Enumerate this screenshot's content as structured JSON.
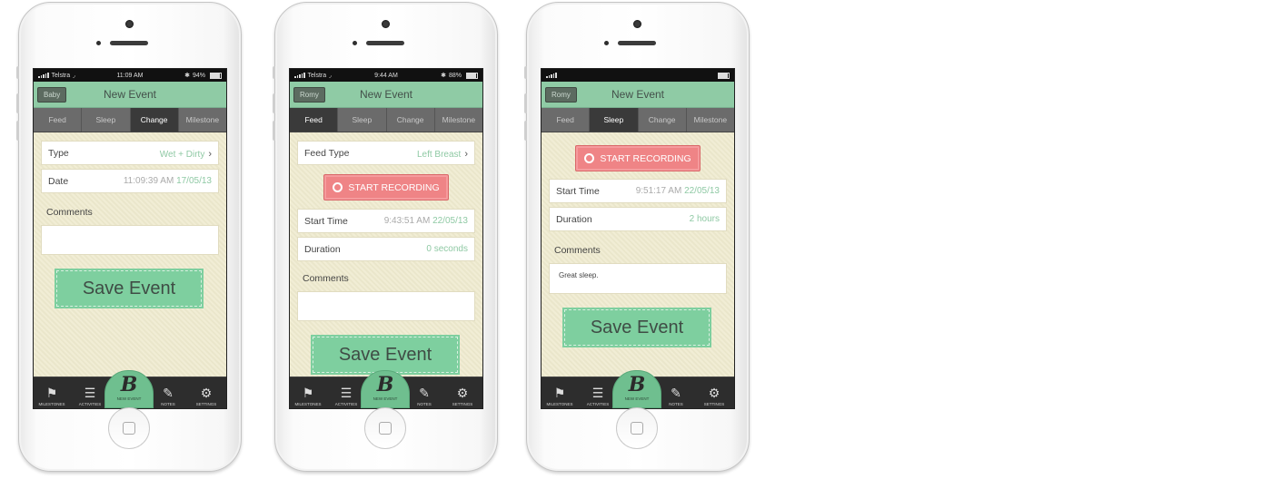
{
  "tab_labels": {
    "milestones": "MILESTONES",
    "activities": "ACTIVITIES",
    "new_event": "NEW EVENT",
    "notes": "NOTES",
    "settings": "SETTINGS"
  },
  "segments": [
    "Feed",
    "Sleep",
    "Change",
    "Milestone"
  ],
  "phones": [
    {
      "status": {
        "carrier": "Telstra",
        "time": "11:09 AM",
        "battery": "94%"
      },
      "nav": {
        "back": "Baby",
        "title": "New Event"
      },
      "active_segment": "Change",
      "type_row": {
        "label": "Type",
        "value": "Wet + Dirty"
      },
      "date_row": {
        "label": "Date",
        "time": "11:09:39 AM",
        "date": "17/05/13"
      },
      "comments_label": "Comments",
      "comments_value": "",
      "save_label": "Save Event"
    },
    {
      "status": {
        "carrier": "Telstra",
        "time": "9:44 AM",
        "battery": "88%"
      },
      "nav": {
        "back": "Romy",
        "title": "New Event"
      },
      "active_segment": "Feed",
      "feed_type_row": {
        "label": "Feed Type",
        "value": "Left Breast"
      },
      "record_label": "START RECORDING",
      "start_row": {
        "label": "Start Time",
        "time": "9:43:51 AM",
        "date": "22/05/13"
      },
      "duration_row": {
        "label": "Duration",
        "value": "0 seconds"
      },
      "comments_label": "Comments",
      "comments_value": "",
      "save_label": "Save Event"
    },
    {
      "nav": {
        "back": "Romy",
        "title": "New Event"
      },
      "active_segment": "Sleep",
      "record_label": "START RECORDING",
      "start_row": {
        "label": "Start Time",
        "time": "9:51:17 AM",
        "date": "22/05/13"
      },
      "duration_row": {
        "label": "Duration",
        "value": "2 hours"
      },
      "comments_label": "Comments",
      "comments_value": "Great sleep.",
      "save_label": "Save Event"
    }
  ],
  "colors": {
    "nav_green": "#8fcba5",
    "accent_green": "#7ecf9f",
    "record_red": "#ef8486",
    "background": "#efebcf"
  }
}
